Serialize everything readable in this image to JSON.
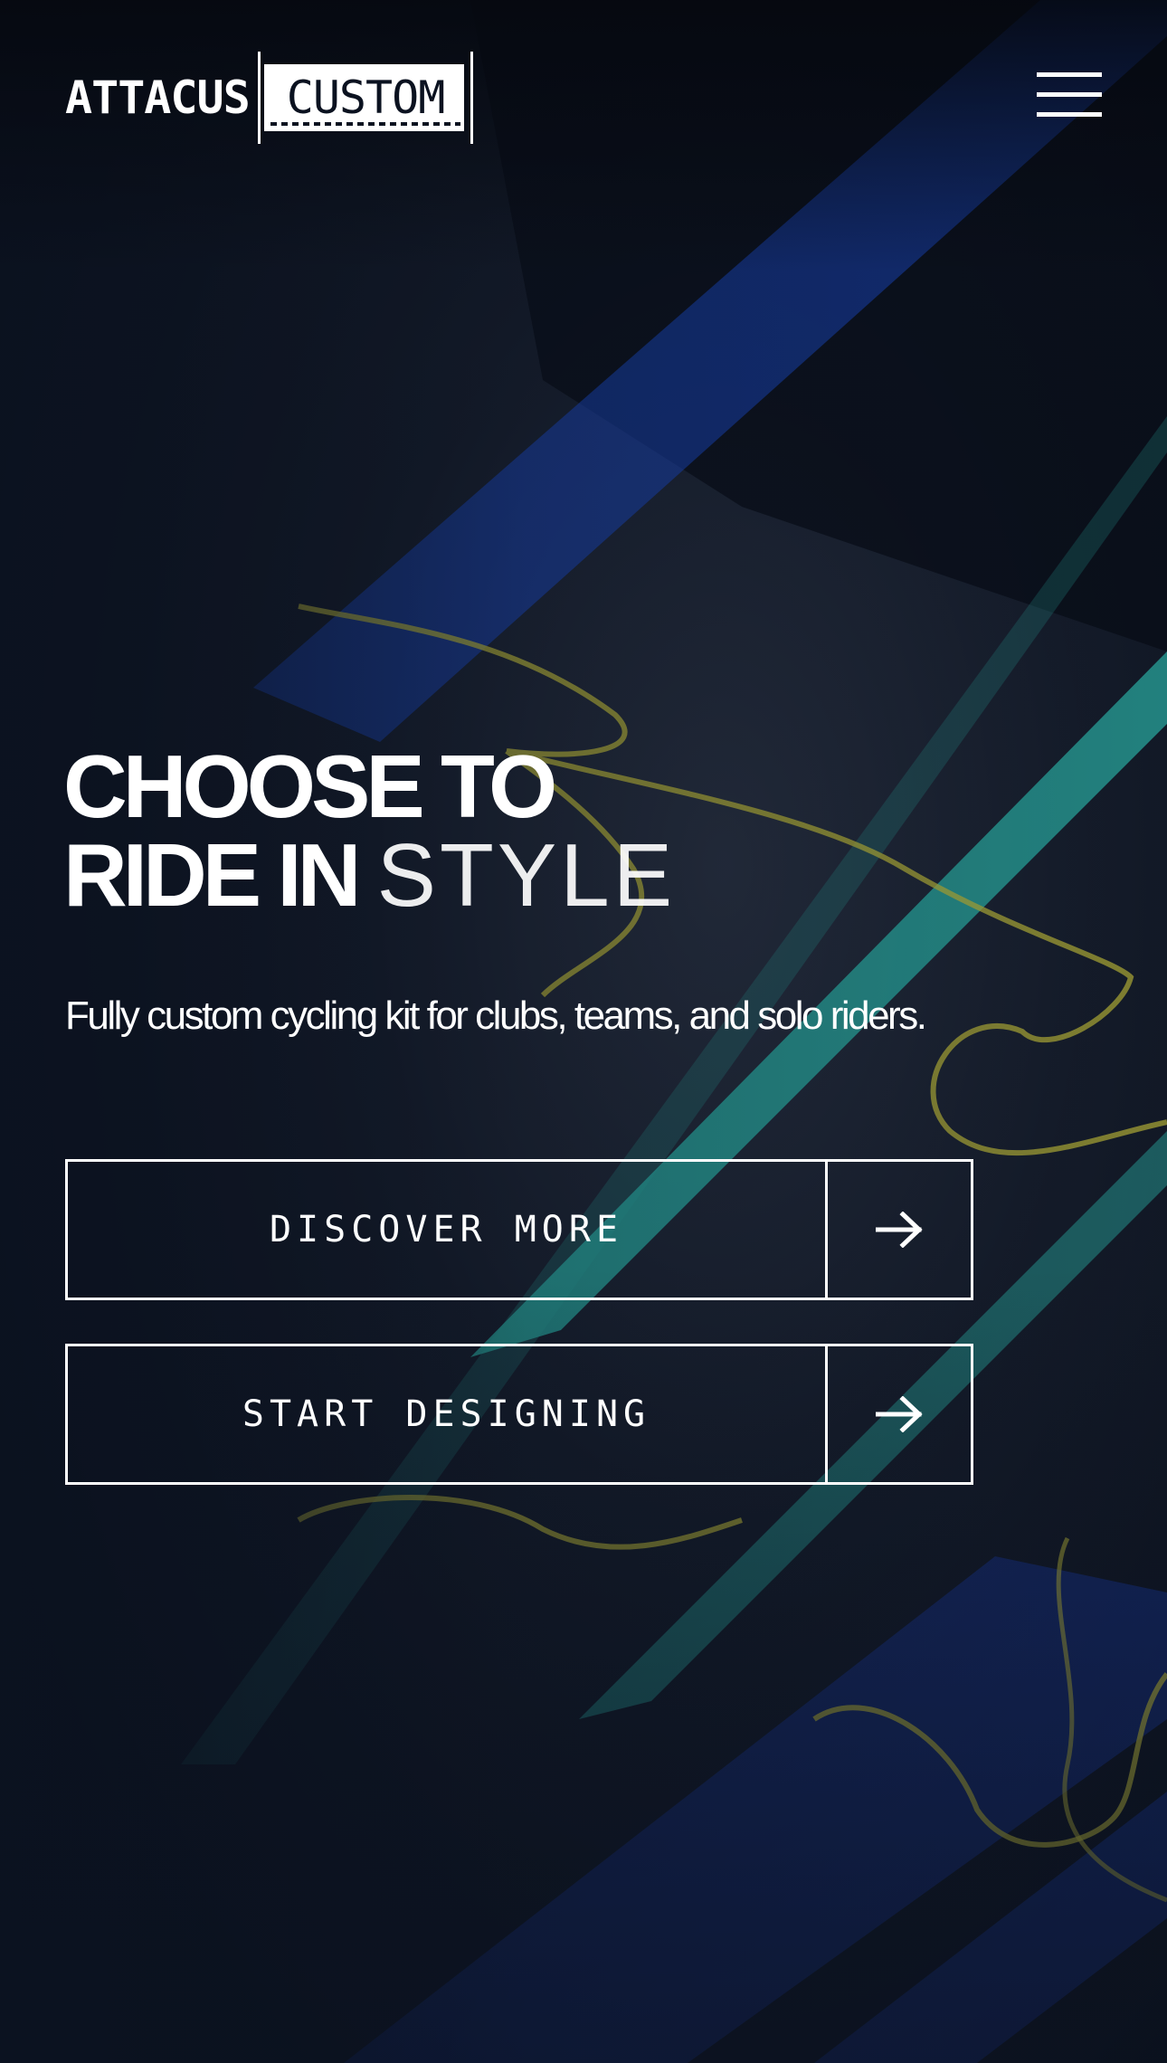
{
  "brand": {
    "logo_word": "ATTACUS",
    "logo_box": "CUSTOM"
  },
  "nav": {
    "menu_icon": "hamburger-menu-icon"
  },
  "hero": {
    "headline_line1": "CHOOSE TO",
    "headline_line2_bold": "RIDE IN",
    "headline_line2_light": "STYLE",
    "subtitle": "Fully custom cycling kit for clubs, teams, and solo riders.",
    "buttons": [
      {
        "label": "DISCOVER MORE",
        "icon": "arrow-right-icon"
      },
      {
        "label": "START DESIGNING",
        "icon": "arrow-right-icon"
      }
    ]
  },
  "colors": {
    "background": "#0b1220",
    "stripe_teal": "#2bb3a8",
    "stripe_blue": "#1f5cff",
    "doodle_yellow": "#c9c43a",
    "text": "#ffffff"
  }
}
